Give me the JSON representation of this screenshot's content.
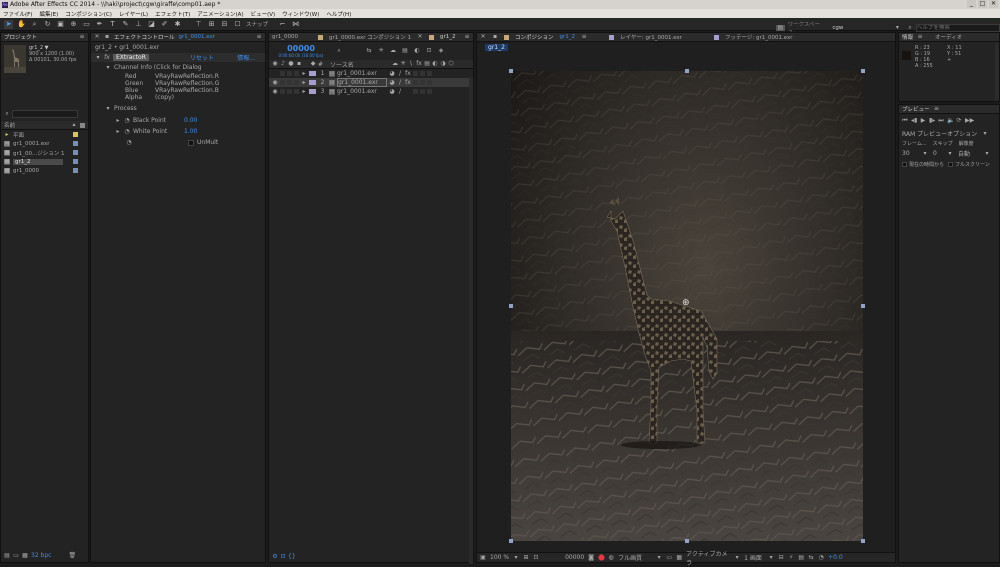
{
  "window": {
    "title": "Adobe After Effects CC 2014 - \\\\haki\\project\\cgw\\giraffe\\comp01.aep *",
    "min": "_",
    "max": "□",
    "close": "✕"
  },
  "menu": [
    "ファイル(F)",
    "編集(E)",
    "コンポジション(C)",
    "レイヤー(L)",
    "エフェクト(T)",
    "アニメーション(A)",
    "ビュー(V)",
    "ウィンドウ(W)",
    "ヘルプ(H)"
  ],
  "toolbar": {
    "snap_label": "スナップ",
    "workspace_label": "ワークスペース:",
    "workspace_value": "cgw",
    "help_placeholder": "ヘルプを検索"
  },
  "project": {
    "tab": "プロジェクト",
    "item_name": "gr1_2 ▼",
    "item_size": "900 x 1200 (1.00)",
    "item_time": "Δ 00101, 30.00 fps",
    "search_placeholder": "",
    "col_name": "名前",
    "items": [
      {
        "name": "平面",
        "color": "#d9c65a",
        "icon": "folder-icon"
      },
      {
        "name": "gr1_0001.exr",
        "color": "#7a8fb5",
        "icon": "footage-icon"
      },
      {
        "name": "gr1_00...ジション 1",
        "color": "#7a8fb5",
        "icon": "comp-icon"
      },
      {
        "name": "gr1_2",
        "color": "#7a8fb5",
        "icon": "comp-icon"
      },
      {
        "name": "gr1_0000",
        "color": "#7a8fb5",
        "icon": "comp-icon"
      }
    ],
    "bpc": "32 bpc"
  },
  "effects": {
    "tab": "エフェクトコントロール",
    "tab_layer": "gr1_0001.exr",
    "breadcrumb": "gr1_2 • gr1_0001.exr",
    "effect_name": "EXtractoR",
    "reset": "リセット",
    "about": "情報...",
    "channel_info": "Channel Info (Click for Dialog",
    "channels": [
      {
        "label": "Red",
        "value": "VRayRawReflection.R"
      },
      {
        "label": "Green",
        "value": "VRayRawReflection.G"
      },
      {
        "label": "Blue",
        "value": "VRayRawReflection.B"
      },
      {
        "label": "Alpha",
        "value": "(copy)"
      }
    ],
    "process": "Process",
    "black_point_label": "Black Point",
    "black_point_value": "0.00",
    "white_point_label": "White Point",
    "white_point_value": "1.00",
    "unmult": "UnMult"
  },
  "timeline": {
    "tabs": [
      "gr1_0000",
      "gr1_0000.exr コンポジション 1",
      "gr1_2"
    ],
    "timecode": "00000",
    "timecode_sub": "0:00:00:00 (30.00 fps)",
    "col_hash": "#",
    "col_source": "ソース名",
    "layers": [
      {
        "num": "1",
        "name": "gr1_0001.exr",
        "color": "#a99ccf"
      },
      {
        "num": "2",
        "name": "gr1_0001.exr",
        "color": "#a99ccf"
      },
      {
        "num": "3",
        "name": "gr1_0001.exr",
        "color": "#a99ccf"
      }
    ]
  },
  "viewer": {
    "tab_comp": "コンポジション",
    "tab_comp_name": "gr1_2",
    "tab_layer": "レイヤー: gr1_0001.exr",
    "tab_footage": "フッテージ: gr1_0001.exr",
    "comp_chip": "gr1_2",
    "zoom": "100 %",
    "time": "00000",
    "quality": "フル画質",
    "camera": "アクティブカメラ",
    "view_count": "1 画面",
    "exposure": "+0.0"
  },
  "info": {
    "tab": "情報",
    "audio_tab": "オーディオ",
    "r": "R : 23",
    "g": "G : 19",
    "b": "B : 16",
    "a": "A : 255",
    "x": "X : 11",
    "y": "Y : 51",
    "plus": "+"
  },
  "preview": {
    "tab": "プレビュー",
    "ram_options": "RAM プレビューオプション",
    "frame_rate_label": "フレーム...",
    "skip_label": "スキップ",
    "resolution_label": "解像度",
    "frame_rate": "30",
    "skip": "0",
    "resolution": "自動",
    "from_current": "現在の時間から",
    "full_screen": "フルスクリーン"
  },
  "colors": {
    "accent": "#3d8ee8",
    "selection_handle": "#8fa4c8",
    "label_purple": "#a99ccf",
    "label_yellow": "#d9c65a"
  }
}
